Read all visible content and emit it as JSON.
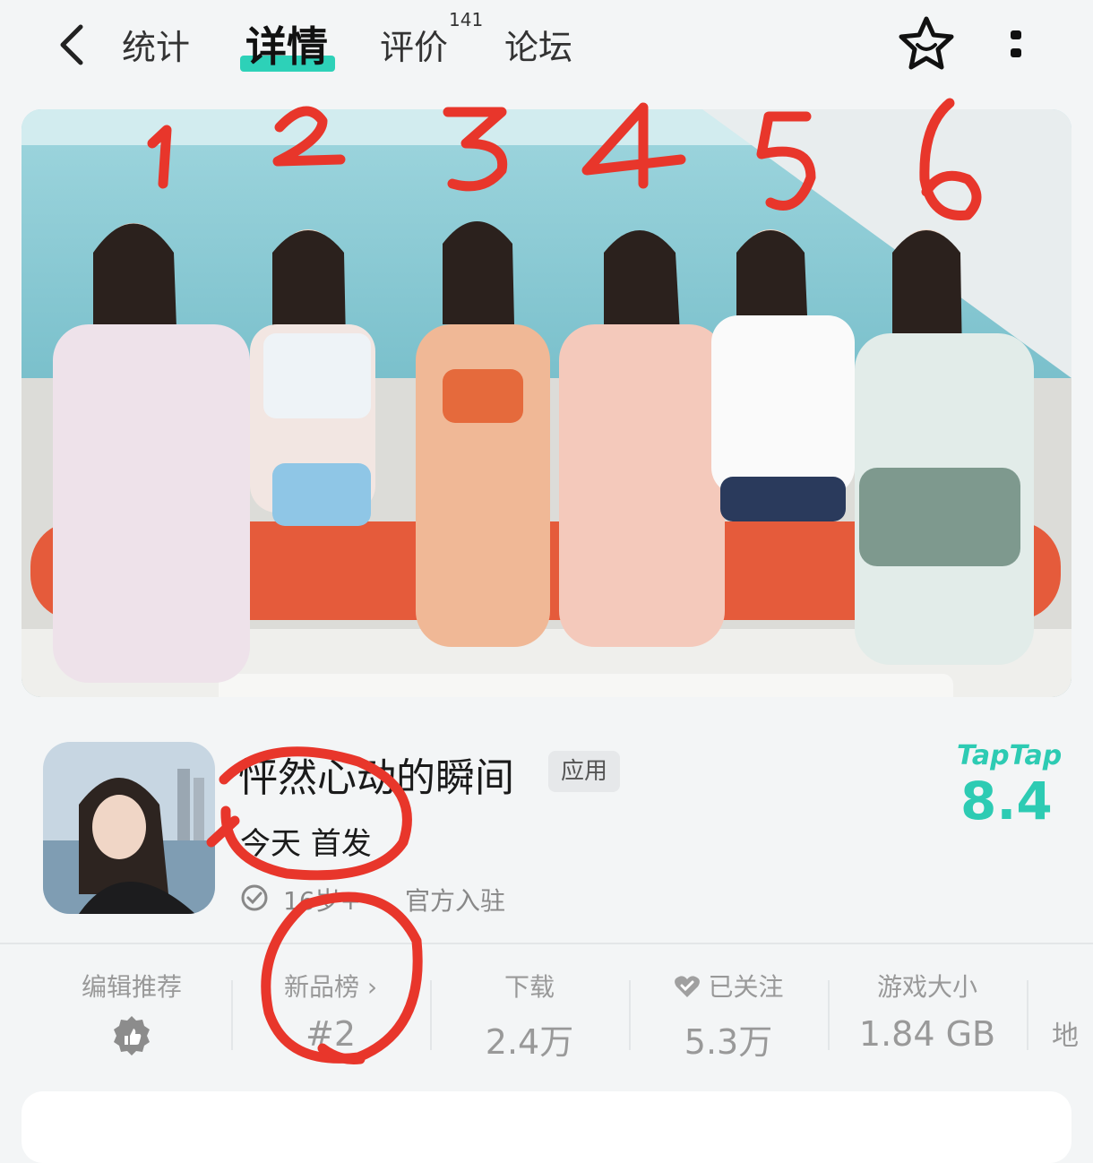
{
  "nav": {
    "tabs": [
      {
        "label": "统计"
      },
      {
        "label": "详情"
      },
      {
        "label": "评价",
        "badge": "141"
      },
      {
        "label": "论坛"
      }
    ]
  },
  "hero": {
    "annotation_numbers": [
      "1",
      "2",
      "3",
      "4",
      "5",
      "6"
    ]
  },
  "app": {
    "name": "怦然心动的瞬间",
    "tag": "应用",
    "release": "今天 首发",
    "verify_text": "16岁+",
    "official": "官方入驻",
    "rating_brand": "TapTap",
    "rating": "8.4"
  },
  "stats": [
    {
      "label": "编辑推荐",
      "icon": "thumbs-up-badge-icon"
    },
    {
      "label": "新品榜 ›",
      "value": "#2"
    },
    {
      "label": "下载",
      "value": "2.4万"
    },
    {
      "label": "已关注",
      "value": "5.3万",
      "icon": "heart-check-icon"
    },
    {
      "label": "游戏大小",
      "value": "1.84 GB"
    },
    {
      "label": "地"
    }
  ],
  "colors": {
    "accent": "#2dd1b8",
    "annotation": "#e8362b"
  }
}
